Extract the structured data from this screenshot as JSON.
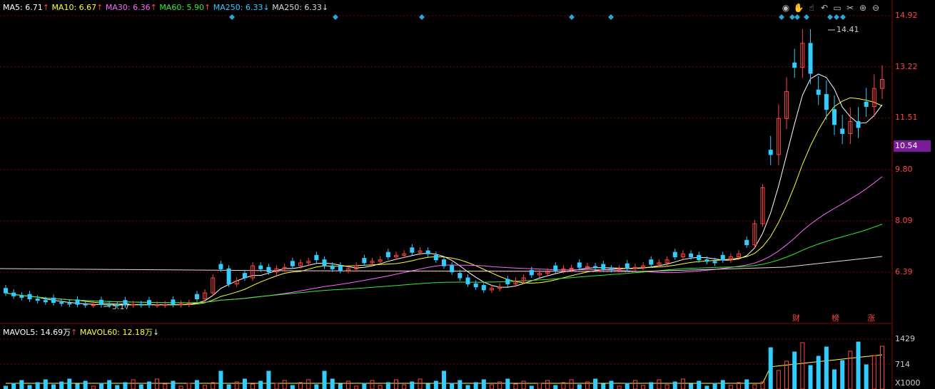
{
  "ma_legend": {
    "ma5": "MA5: 6.71",
    "ma5_arrow": "↑",
    "ma10": "MA10: 6.67",
    "ma10_arrow": "↑",
    "ma30": "MA30: 6.36",
    "ma30_arrow": "↑",
    "ma60": "MA60: 5.90",
    "ma60_arrow": "↑",
    "ma250a": "MA250: 6.33",
    "ma250a_arrow": "↓",
    "ma250b": "MA250: 6.33",
    "ma250b_arrow": "↓"
  },
  "price_axis": [
    "14.92",
    "13.22",
    "11.51",
    "9.80",
    "8.09",
    "6.39"
  ],
  "current_price": "10.54",
  "high_label": "14.41",
  "low_label": "5.17",
  "events": [
    "财",
    "榜",
    "涨"
  ],
  "vol_legend": {
    "mavol5": "MAVOL5: 14.69万",
    "mavol5_arrow": "↑",
    "mavol60": "MAVOL60: 12.18万",
    "mavol60_arrow": "↓"
  },
  "vol_axis": [
    "1429",
    "714",
    "X1000"
  ],
  "toolbar": [
    "eye-icon",
    "hand-icon",
    "grab-icon",
    "undo-icon",
    "lock-icon",
    "scissors-icon",
    "zoom-in-icon",
    "zoom-out-icon"
  ],
  "colors": {
    "up": "#ff4444",
    "down": "#33ccff",
    "grid": "#8b0000",
    "ma5": "#ffffff",
    "ma10": "#ffff33",
    "ma30": "#ff66ff",
    "ma60": "#33ee33",
    "ma250": "#dddddd"
  },
  "chart_data": {
    "type": "candlestick",
    "y_range": [
      5.17,
      14.92
    ],
    "high": 14.41,
    "low": 5.17,
    "current": 10.54,
    "closes": [
      5.7,
      5.6,
      5.55,
      5.5,
      5.45,
      5.4,
      5.38,
      5.35,
      5.33,
      5.32,
      5.3,
      5.3,
      5.31,
      5.3,
      5.29,
      5.3,
      5.32,
      5.31,
      5.3,
      5.3,
      5.31,
      5.32,
      5.33,
      5.35,
      5.5,
      5.7,
      6.2,
      6.5,
      6.0,
      6.1,
      6.2,
      6.6,
      6.5,
      6.4,
      6.5,
      6.55,
      6.6,
      6.7,
      6.75,
      6.8,
      6.6,
      6.5,
      6.45,
      6.5,
      6.6,
      6.7,
      6.75,
      6.8,
      6.9,
      6.95,
      7.0,
      7.05,
      7.1,
      7.0,
      6.8,
      6.6,
      6.4,
      6.2,
      6.0,
      5.9,
      5.8,
      5.85,
      5.9,
      6.0,
      6.1,
      6.2,
      6.3,
      6.35,
      6.4,
      6.45,
      6.5,
      6.52,
      6.55,
      6.58,
      6.55,
      6.5,
      6.48,
      6.5,
      6.52,
      6.55,
      6.6,
      6.65,
      6.7,
      6.8,
      6.9,
      7.0,
      6.9,
      6.8,
      6.75,
      6.7,
      6.8,
      6.9,
      7.0,
      7.3,
      8.0,
      9.2,
      10.3,
      11.5,
      12.4,
      13.2,
      14.0,
      13.0,
      12.3,
      11.8,
      11.3,
      11.0,
      11.4,
      11.2,
      11.9,
      12.5,
      12.8
    ]
  }
}
